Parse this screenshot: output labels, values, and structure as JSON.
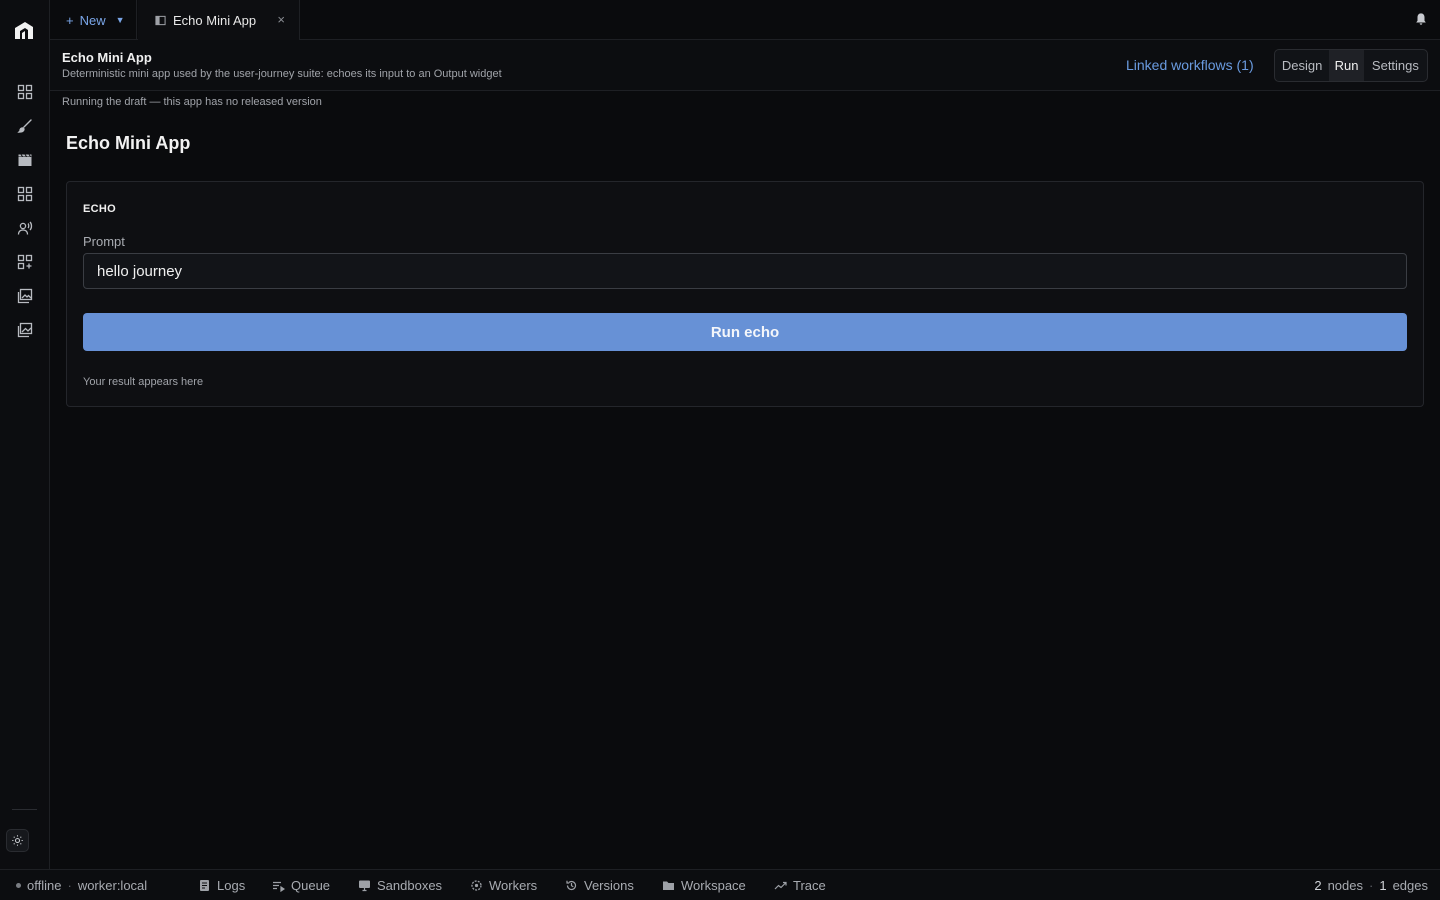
{
  "tabbar": {
    "new_label": "New",
    "active_tab": "Echo Mini App",
    "close_glyph": "×"
  },
  "rail": {
    "icons": [
      "home-grid-icon",
      "brush-icon",
      "clapperboard-icon",
      "apps-grid-icon",
      "voice-user-icon",
      "add-app-icon",
      "image-gallery-icon",
      "gallery-stack-icon"
    ],
    "theme_icon": "sun-icon"
  },
  "app_header": {
    "title": "Echo Mini App",
    "description": "Deterministic mini app used by the user-journey suite: echoes its input to an Output widget",
    "linked_workflows": "Linked workflows (1)",
    "modes": [
      "Design",
      "Run",
      "Settings"
    ],
    "active_mode": "Run"
  },
  "draft_note": "Running the draft — this app has no released version",
  "page_title": "Echo Mini App",
  "card": {
    "heading": "ECHO",
    "prompt_label": "Prompt",
    "prompt_value": "hello journey",
    "run_label": "Run echo",
    "result_placeholder": "Your result appears here"
  },
  "statusbar": {
    "connection": "offline",
    "worker": "worker:local",
    "items": [
      "Logs",
      "Queue",
      "Sandboxes",
      "Workers",
      "Versions",
      "Workspace",
      "Trace"
    ],
    "nodes_count": "2",
    "nodes_label": "nodes",
    "edges_count": "1",
    "edges_label": "edges"
  },
  "colors": {
    "accent": "#6791d6",
    "link": "#6a9be0",
    "background": "#0a0b0d"
  }
}
